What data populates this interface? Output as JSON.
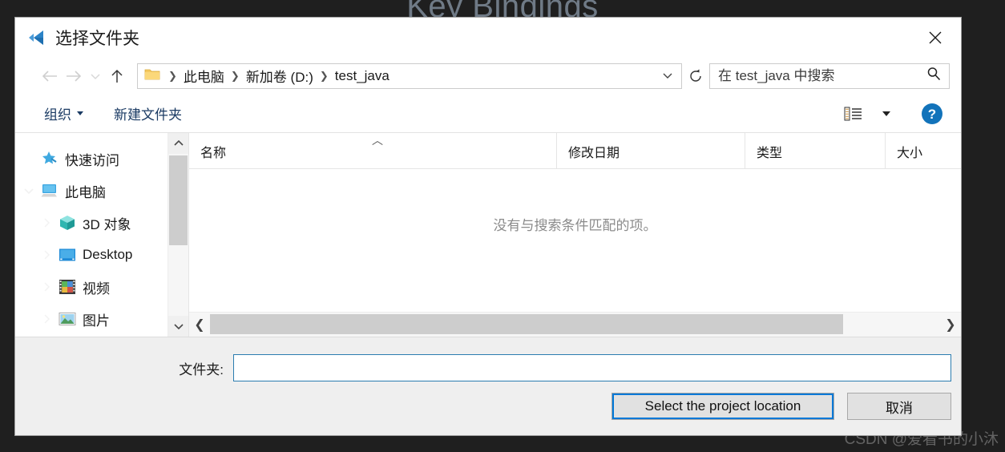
{
  "backdrop": {
    "title": "Key Bindings",
    "watermark": "CSDN @爱看书的小沐",
    "bg_color": "#1f1f1f"
  },
  "dialog": {
    "title": "选择文件夹",
    "app_icon": "vscode-icon",
    "close_icon": "close-icon"
  },
  "navbar": {
    "back_icon": "arrow-left-icon",
    "forward_icon": "arrow-right-icon",
    "recent_icon": "chevron-down-icon",
    "up_icon": "arrow-up-icon",
    "refresh_icon": "refresh-icon",
    "folder_icon": "folder-icon",
    "dropdown_icon": "chevron-down-icon",
    "separator": "❯",
    "breadcrumbs": [
      {
        "label": "此电脑"
      },
      {
        "label": "新加卷 (D:)"
      },
      {
        "label": "test_java"
      }
    ]
  },
  "search": {
    "placeholder": "在 test_java 中搜索",
    "value": "",
    "icon": "search-icon"
  },
  "toolbar": {
    "organize_label": "组织",
    "new_folder_label": "新建文件夹",
    "view_options_icon": "view-options-icon",
    "view_caret_icon": "caret-down-icon",
    "help_icon": "help-icon",
    "accent_color": "#1a3a63"
  },
  "tree": {
    "items": [
      {
        "label": "快速访问",
        "icon": "star-pin-icon",
        "indent": 0,
        "chevron": "none"
      },
      {
        "label": "此电脑",
        "icon": "this-pc-icon",
        "indent": 0,
        "chevron": "expanded"
      },
      {
        "label": "3D 对象",
        "icon": "3d-objects-icon",
        "indent": 1,
        "chevron": "collapsed"
      },
      {
        "label": "Desktop",
        "icon": "desktop-icon",
        "indent": 1,
        "chevron": "collapsed"
      },
      {
        "label": "视频",
        "icon": "videos-icon",
        "indent": 1,
        "chevron": "collapsed"
      },
      {
        "label": "图片",
        "icon": "pictures-icon",
        "indent": 1,
        "chevron": "collapsed"
      }
    ],
    "scrollbar": {
      "up_icon": "chevron-up-icon",
      "down_icon": "chevron-down-icon"
    }
  },
  "filelist": {
    "columns": [
      {
        "label": "名称",
        "sorted": "asc"
      },
      {
        "label": "修改日期",
        "sorted": ""
      },
      {
        "label": "类型",
        "sorted": ""
      },
      {
        "label": "大小",
        "sorted": ""
      }
    ],
    "sort_caret": "︿",
    "empty_message": "没有与搜索条件匹配的项。",
    "rows": [],
    "hscroll": {
      "left_icon": "chevron-left-icon",
      "right_icon": "chevron-right-icon"
    }
  },
  "footer": {
    "folder_label": "文件夹:",
    "folder_value": "",
    "folder_placeholder": "",
    "select_button": "Select the project location",
    "cancel_button": "取消",
    "focus_color": "#0078d7"
  }
}
